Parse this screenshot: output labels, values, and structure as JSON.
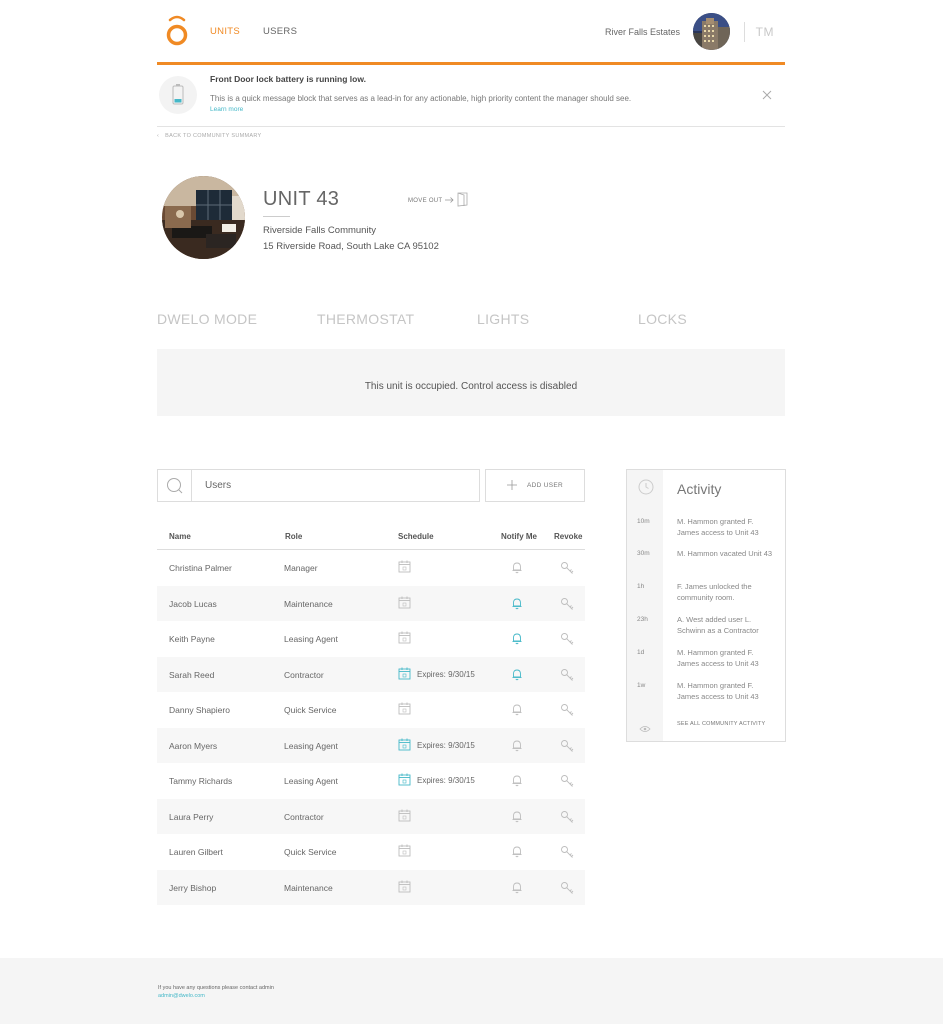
{
  "header": {
    "nav": {
      "units": "UNITS",
      "users": "USERS"
    },
    "community_name": "River Falls Estates",
    "user_initials": "TM",
    "accent_color": "#f08a24"
  },
  "alert": {
    "title": "Front Door lock battery is running low.",
    "message": "This is a quick message block that serves as a lead-in for any actionable, high priority content the manager should see.",
    "link": "Learn more",
    "icon": "battery-low-icon"
  },
  "back_link": "BACK TO COMMUNITY SUMMARY",
  "unit": {
    "title": "UNIT 43",
    "community": "Riverside Falls Community",
    "address": "15 Riverside Road, South Lake CA 95102",
    "move_out": "MOVE OUT"
  },
  "tabs": [
    "DWELO MODE",
    "THERMOSTAT",
    "LIGHTS",
    "LOCKS"
  ],
  "control_message": "This unit is occupied. Control access is disabled",
  "search": {
    "placeholder": "Users"
  },
  "add_user": "ADD USER",
  "table": {
    "headers": {
      "name": "Name",
      "role": "Role",
      "schedule": "Schedule",
      "notify": "Notify Me",
      "revoke": "Revoke"
    },
    "rows": [
      {
        "name": "Christina Palmer",
        "role": "Manager",
        "expires": "",
        "notify_active": false,
        "schedule_active": false
      },
      {
        "name": "Jacob Lucas",
        "role": "Maintenance",
        "expires": "",
        "notify_active": true,
        "schedule_active": false
      },
      {
        "name": "Keith Payne",
        "role": "Leasing Agent",
        "expires": "",
        "notify_active": true,
        "schedule_active": false
      },
      {
        "name": "Sarah Reed",
        "role": "Contractor",
        "expires": "Expires: 9/30/15",
        "notify_active": true,
        "schedule_active": true
      },
      {
        "name": "Danny Shapiero",
        "role": "Quick Service",
        "expires": "",
        "notify_active": false,
        "schedule_active": false
      },
      {
        "name": "Aaron Myers",
        "role": "Leasing Agent",
        "expires": "Expires: 9/30/15",
        "notify_active": false,
        "schedule_active": true
      },
      {
        "name": "Tammy Richards",
        "role": "Leasing Agent",
        "expires": "Expires: 9/30/15",
        "notify_active": false,
        "schedule_active": true
      },
      {
        "name": "Laura Perry",
        "role": "Contractor",
        "expires": "",
        "notify_active": false,
        "schedule_active": false
      },
      {
        "name": "Lauren Gilbert",
        "role": "Quick Service",
        "expires": "",
        "notify_active": false,
        "schedule_active": false
      },
      {
        "name": "Jerry Bishop",
        "role": "Maintenance",
        "expires": "",
        "notify_active": false,
        "schedule_active": false
      }
    ]
  },
  "activity": {
    "title": "Activity",
    "items": [
      {
        "time": "10m",
        "text": "M. Hammon granted F. James access to Unit 43"
      },
      {
        "time": "30m",
        "text": "M. Hammon vacated Unit 43"
      },
      {
        "time": "1h",
        "text": "F. James unlocked the community room."
      },
      {
        "time": "23h",
        "text": "A. West added user L. Schwinn as a Contractor"
      },
      {
        "time": "1d",
        "text": "M. Hammon granted F. James access to Unit 43"
      },
      {
        "time": "1w",
        "text": "M. Hammon granted F. James access to Unit 43"
      }
    ],
    "see_all": "SEE ALL COMMUNITY ACTIVITY"
  },
  "footer": {
    "text": "If you have any questions please contact admin",
    "email": "admin@dwelo.com"
  },
  "colors": {
    "active_icon": "#45b8c8",
    "inactive_icon": "#bdbdbd"
  }
}
